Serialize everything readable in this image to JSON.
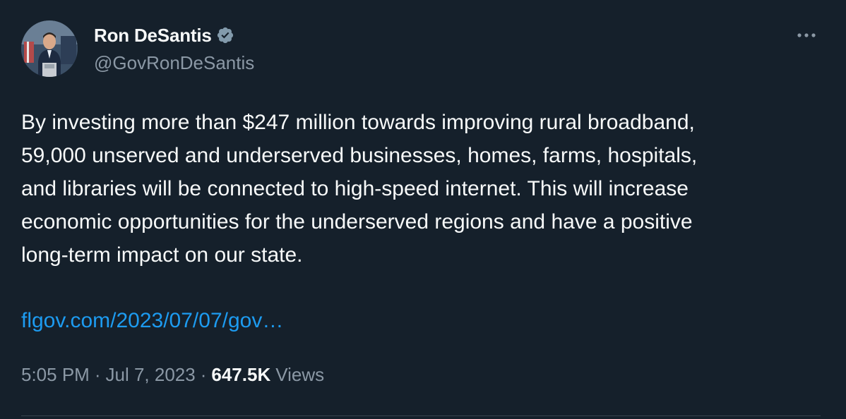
{
  "author": {
    "display_name": "Ron DeSantis",
    "handle": "@GovRonDeSantis",
    "verified": true,
    "avatar_icon": "profile-photo"
  },
  "tweet": {
    "text": "By investing more than $247 million towards improving rural broadband,\n59,000 unserved and underserved businesses, homes, farms, hospitals,\nand libraries will be connected to high-speed internet. This will increase\neconomic opportunities for the underserved regions and have a positive\nlong-term impact on our state.",
    "link_text": "flgov.com/2023/07/07/gov…"
  },
  "meta": {
    "time": "5:05 PM",
    "separator": "·",
    "date": "Jul 7, 2023",
    "views_count": "647.5K",
    "views_label": "Views"
  },
  "colors": {
    "background": "#15202b",
    "text_primary": "#f7f9f9",
    "text_secondary": "#8b98a5",
    "link": "#1d9bf0",
    "verified_badge": "#829aab",
    "divider": "#38444d"
  },
  "icons": {
    "verified": "verified-badge-icon",
    "more": "more-horizontal-icon"
  }
}
